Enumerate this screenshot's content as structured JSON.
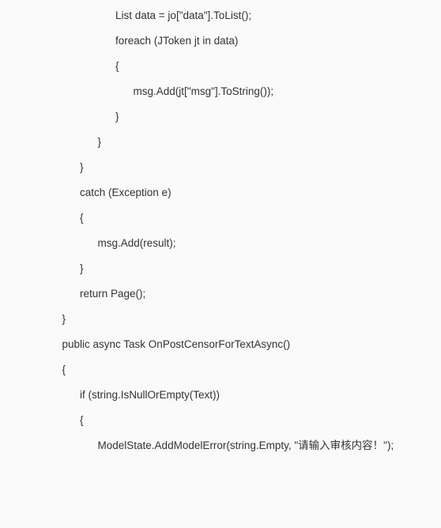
{
  "lines": [
    {
      "indent": 4,
      "text": "List data = jo[\"data\"].ToList();"
    },
    {
      "indent": 4,
      "text": "foreach (JToken jt in data)"
    },
    {
      "indent": 4,
      "text": "{"
    },
    {
      "indent": 5,
      "text": "msg.Add(jt[\"msg\"].ToString());"
    },
    {
      "indent": 4,
      "text": "}"
    },
    {
      "indent": 3,
      "text": "}"
    },
    {
      "indent": 2,
      "text": "}"
    },
    {
      "indent": 2,
      "text": "catch (Exception e)"
    },
    {
      "indent": 2,
      "text": "{"
    },
    {
      "indent": 3,
      "text": "msg.Add(result);"
    },
    {
      "indent": 2,
      "text": "}"
    },
    {
      "indent": 2,
      "text": "return Page();"
    },
    {
      "indent": 1,
      "text": "}"
    },
    {
      "indent": 0,
      "text": ""
    },
    {
      "indent": 0,
      "text": ""
    },
    {
      "indent": 0,
      "text": ""
    },
    {
      "indent": 0,
      "text": ""
    },
    {
      "indent": 1,
      "text": "public async Task OnPostCensorForTextAsync()"
    },
    {
      "indent": 1,
      "text": "{"
    },
    {
      "indent": 2,
      "text": "if (string.IsNullOrEmpty(Text))"
    },
    {
      "indent": 2,
      "text": "{"
    },
    {
      "indent": 3,
      "text": "ModelState.AddModelError(string.Empty, \"请输入审核内容！\");"
    }
  ],
  "indentUnit": "      "
}
